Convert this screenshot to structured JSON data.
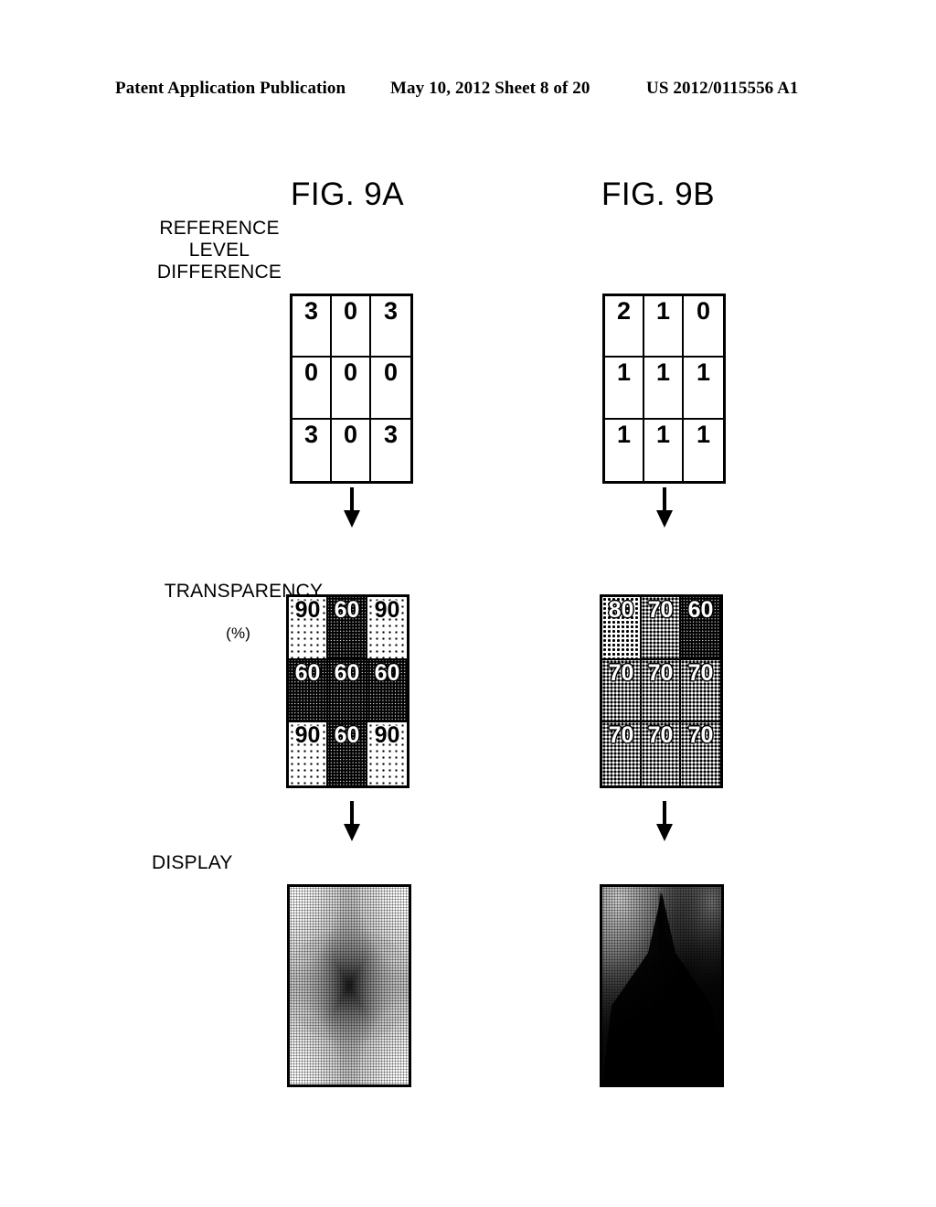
{
  "header": {
    "publication": "Patent Application Publication",
    "date_sheet": "May 10, 2012  Sheet 8 of 20",
    "pub_number": "US 2012/0115556 A1"
  },
  "figures": {
    "a": {
      "title": "FIG. 9A"
    },
    "b": {
      "title": "FIG. 9B"
    }
  },
  "labels": {
    "reference_level_difference": "REFERENCE\nLEVEL\nDIFFERENCE",
    "transparency": "TRANSPARENCY",
    "transparency_unit": "(%)",
    "display": "DISPLAY"
  },
  "icons": {
    "arrow": "down-arrow-icon"
  },
  "chart_data": [
    {
      "type": "table",
      "name": "fig9a-reference-level-difference",
      "title": "FIG. 9A — REFERENCE LEVEL DIFFERENCE",
      "rows": 3,
      "cols": 3,
      "values": [
        [
          3,
          0,
          3
        ],
        [
          0,
          0,
          0
        ],
        [
          3,
          0,
          3
        ]
      ]
    },
    {
      "type": "table",
      "name": "fig9b-reference-level-difference",
      "title": "FIG. 9B — REFERENCE LEVEL DIFFERENCE",
      "rows": 3,
      "cols": 3,
      "values": [
        [
          2,
          1,
          0
        ],
        [
          1,
          1,
          1
        ],
        [
          1,
          1,
          1
        ]
      ]
    },
    {
      "type": "heatmap",
      "name": "fig9a-transparency",
      "title": "FIG. 9A — TRANSPARENCY (%)",
      "rows": 3,
      "cols": 3,
      "unit": "%",
      "values": [
        [
          90,
          60,
          90
        ],
        [
          60,
          60,
          60
        ],
        [
          90,
          60,
          90
        ]
      ],
      "shading_note": "higher percentage rendered as lighter dot screen"
    },
    {
      "type": "heatmap",
      "name": "fig9b-transparency",
      "title": "FIG. 9B — TRANSPARENCY (%)",
      "rows": 3,
      "cols": 3,
      "unit": "%",
      "values": [
        [
          80,
          70,
          60
        ],
        [
          70,
          70,
          70
        ],
        [
          70,
          70,
          70
        ]
      ],
      "shading_note": "higher percentage rendered as lighter dot screen"
    }
  ],
  "matrix_a": {
    "cells": [
      {
        "value": "3"
      },
      {
        "value": "0"
      },
      {
        "value": "3"
      },
      {
        "value": "0"
      },
      {
        "value": "0"
      },
      {
        "value": "0"
      },
      {
        "value": "3"
      },
      {
        "value": "0"
      },
      {
        "value": "3"
      }
    ]
  },
  "matrix_b": {
    "cells": [
      {
        "value": "2"
      },
      {
        "value": "1"
      },
      {
        "value": "0"
      },
      {
        "value": "1"
      },
      {
        "value": "1"
      },
      {
        "value": "1"
      },
      {
        "value": "1"
      },
      {
        "value": "1"
      },
      {
        "value": "1"
      }
    ]
  },
  "transparency_a": {
    "cells": [
      {
        "value": "90"
      },
      {
        "value": "60"
      },
      {
        "value": "90"
      },
      {
        "value": "60"
      },
      {
        "value": "60"
      },
      {
        "value": "60"
      },
      {
        "value": "90"
      },
      {
        "value": "60"
      },
      {
        "value": "90"
      }
    ]
  },
  "transparency_b": {
    "cells": [
      {
        "value": "80"
      },
      {
        "value": "70"
      },
      {
        "value": "60"
      },
      {
        "value": "70"
      },
      {
        "value": "70"
      },
      {
        "value": "70"
      },
      {
        "value": "70"
      },
      {
        "value": "70"
      },
      {
        "value": "70"
      }
    ]
  },
  "display_a": {
    "description": "dark four-pointed star / diamond pattern, light corners"
  },
  "display_b": {
    "description": "mostly dark panel, lighter gradient toward the top-left corner"
  }
}
